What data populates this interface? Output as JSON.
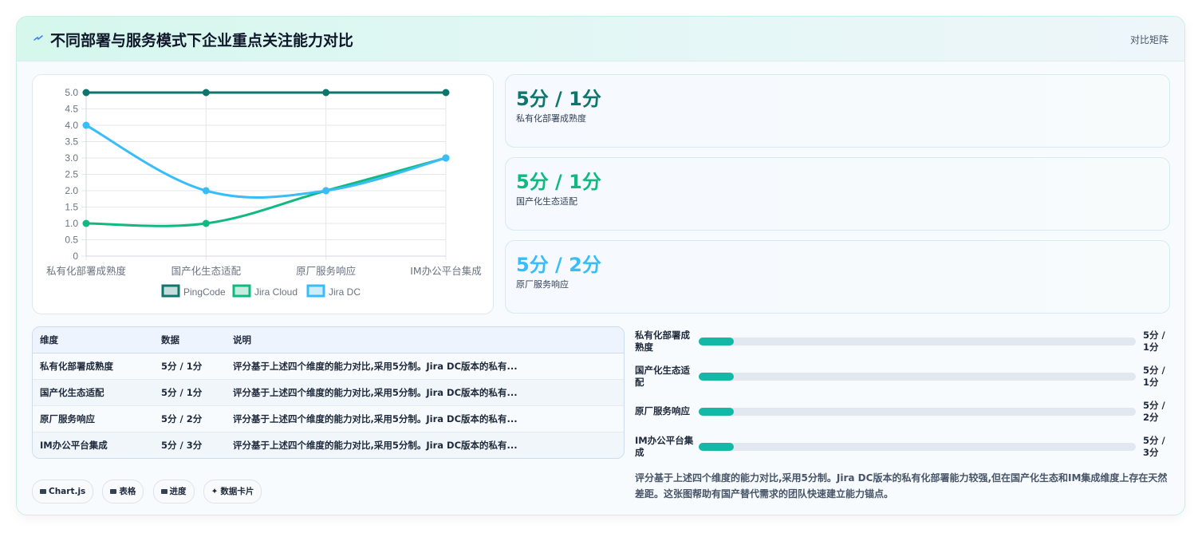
{
  "header": {
    "title": "不同部署与服务模式下企业重点关注能力对比",
    "right_label": "对比矩阵",
    "icon": "sparkle-icon"
  },
  "chart_data": {
    "type": "line",
    "categories": [
      "私有化部署成熟度",
      "国产化生态适配",
      "原厂服务响应",
      "IM办公平台集成"
    ],
    "ylim": [
      0,
      5.0
    ],
    "yticks": [
      "0",
      "0.5",
      "1.0",
      "1.5",
      "2.0",
      "2.5",
      "3.0",
      "3.5",
      "4.0",
      "4.5",
      "5.0"
    ],
    "grid": true,
    "legend_position": "bottom",
    "series": [
      {
        "name": "PingCode",
        "values": [
          5,
          5,
          5,
          5
        ],
        "color": "#0f766e"
      },
      {
        "name": "Jira Cloud",
        "values": [
          1,
          1,
          2,
          3
        ],
        "color": "#10b981"
      },
      {
        "name": "Jira DC",
        "values": [
          4,
          2,
          2,
          3
        ],
        "color": "#38bdf8"
      }
    ]
  },
  "stats": [
    {
      "value": "5分 / 1分",
      "label": "私有化部署成熟度",
      "color": "#0f766e"
    },
    {
      "value": "5分 / 1分",
      "label": "国产化生态适配",
      "color": "#10b981"
    },
    {
      "value": "5分 / 2分",
      "label": "原厂服务响应",
      "color": "#38bdf8"
    }
  ],
  "table": {
    "headers": [
      "维度",
      "数据",
      "说明"
    ],
    "rows": [
      [
        "私有化部署成熟度",
        "5分 / 1分",
        "评分基于上述四个维度的能力对比,采用5分制。Jira DC版本的私有..."
      ],
      [
        "国产化生态适配",
        "5分 / 1分",
        "评分基于上述四个维度的能力对比,采用5分制。Jira DC版本的私有..."
      ],
      [
        "原厂服务响应",
        "5分 / 2分",
        "评分基于上述四个维度的能力对比,采用5分制。Jira DC版本的私有..."
      ],
      [
        "IM办公平台集成",
        "5分 / 3分",
        "评分基于上述四个维度的能力对比,采用5分制。Jira DC版本的私有..."
      ]
    ]
  },
  "progress": [
    {
      "label": "私有化部署成熟度",
      "value": "5分 / 1分",
      "fraction": 0.08
    },
    {
      "label": "国产化生态适配",
      "value": "5分 / 1分",
      "fraction": 0.08
    },
    {
      "label": "原厂服务响应",
      "value": "5分 / 2分",
      "fraction": 0.08
    },
    {
      "label": "IM办公平台集成",
      "value": "5分 / 3分",
      "fraction": 0.08
    }
  ],
  "note": "评分基于上述四个维度的能力对比,采用5分制。Jira DC版本的私有化部署能力较强,但在国产化生态和IM集成维度上存在天然差距。这张图帮助有国产替代需求的团队快速建立能力锚点。",
  "pills": [
    "Chart.js",
    "表格",
    "进度",
    "数据卡片"
  ]
}
